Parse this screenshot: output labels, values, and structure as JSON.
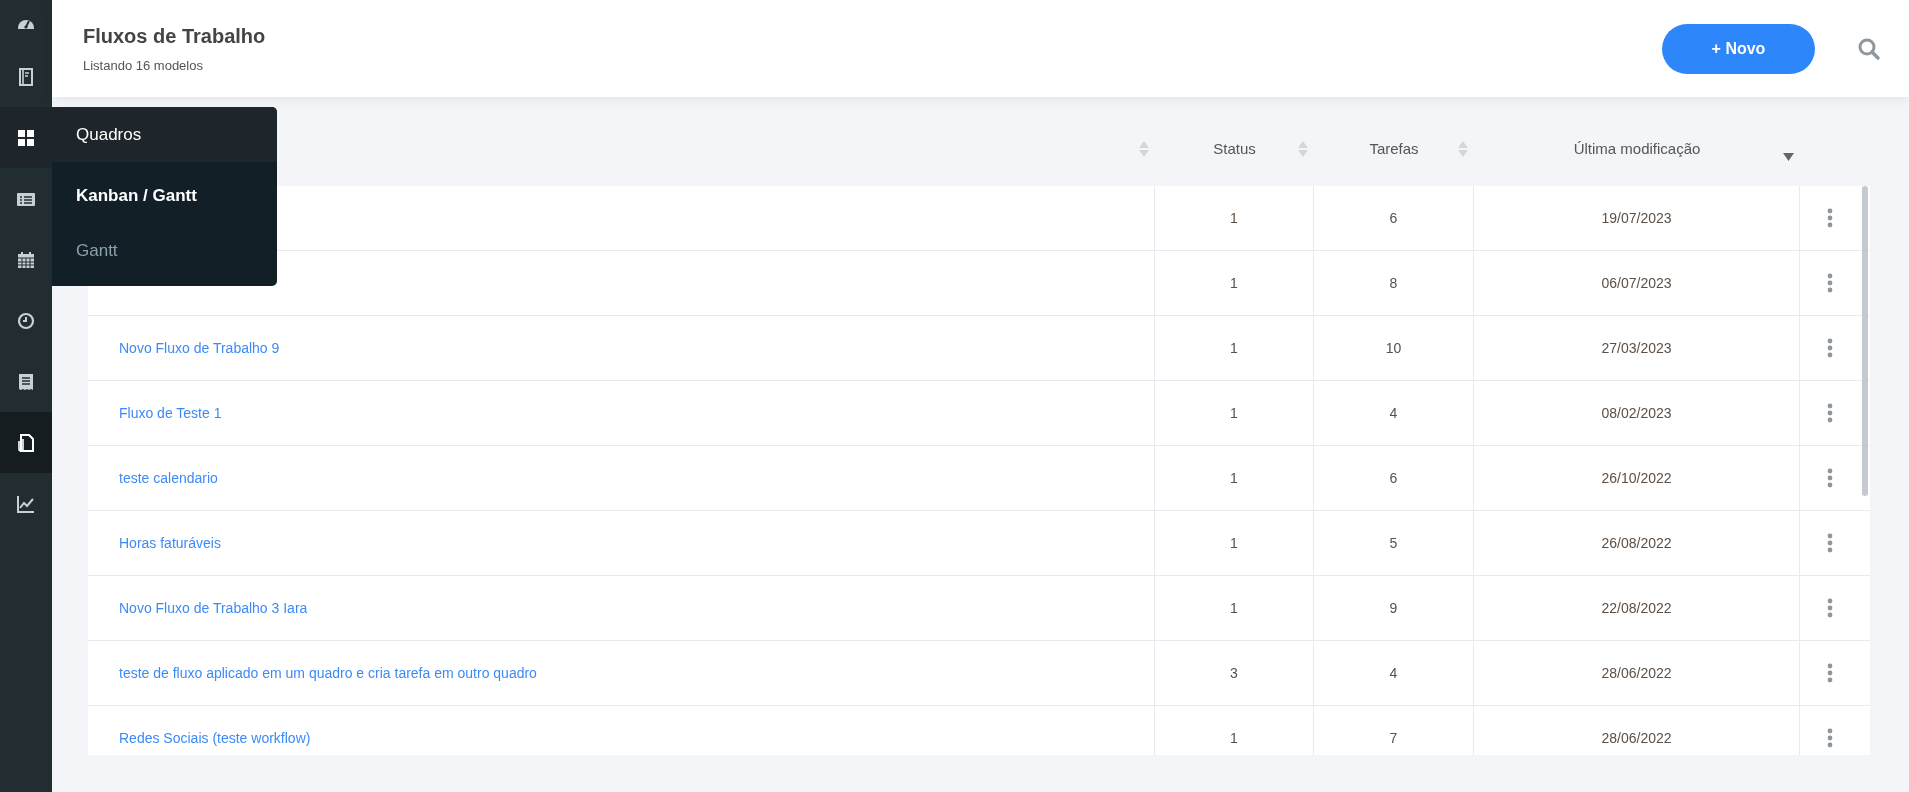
{
  "sidebar": {
    "items": [
      {
        "selected": false
      },
      {
        "selected": false
      },
      {
        "selected": false,
        "flyout": {
          "title": "Quadros",
          "items": [
            {
              "label": "Kanban / Gantt",
              "selected": true
            },
            {
              "label": "Gantt",
              "selected": false
            }
          ]
        }
      },
      {
        "selected": false
      },
      {
        "selected": false
      },
      {
        "selected": false
      },
      {
        "selected": false
      },
      {
        "selected": true
      },
      {
        "selected": false
      }
    ]
  },
  "header": {
    "title": "Fluxos de Trabalho",
    "subtitle": "Listando 16 modelos",
    "new_button": "+ Novo"
  },
  "table": {
    "columns": [
      {
        "sorted": false
      },
      {
        "label": "Status",
        "sorted": false
      },
      {
        "label": "Tarefas",
        "sorted": false
      },
      {
        "label": "Última modificação",
        "sorted": true
      }
    ],
    "rows": [
      {
        "status": "1",
        "tasks": "6",
        "modified": "19/07/2023"
      },
      {
        "status": "1",
        "tasks": "8",
        "modified": "06/07/2023"
      },
      {
        "name": "Novo Fluxo de Trabalho 9",
        "status": "1",
        "tasks": "10",
        "modified": "27/03/2023"
      },
      {
        "name": "Fluxo de Teste 1",
        "status": "1",
        "tasks": "4",
        "modified": "08/02/2023"
      },
      {
        "name": "teste calendario",
        "status": "1",
        "tasks": "6",
        "modified": "26/10/2022"
      },
      {
        "name": "Horas faturáveis",
        "status": "1",
        "tasks": "5",
        "modified": "26/08/2022"
      },
      {
        "name": "Novo Fluxo de Trabalho 3 Iara",
        "status": "1",
        "tasks": "9",
        "modified": "22/08/2022"
      },
      {
        "name": "teste de fluxo aplicado em um quadro e cria tarefa em outro quadro",
        "status": "3",
        "tasks": "4",
        "modified": "28/06/2022"
      },
      {
        "name": "Redes Sociais (teste workflow)",
        "status": "1",
        "tasks": "7",
        "modified": "28/06/2022"
      }
    ]
  }
}
